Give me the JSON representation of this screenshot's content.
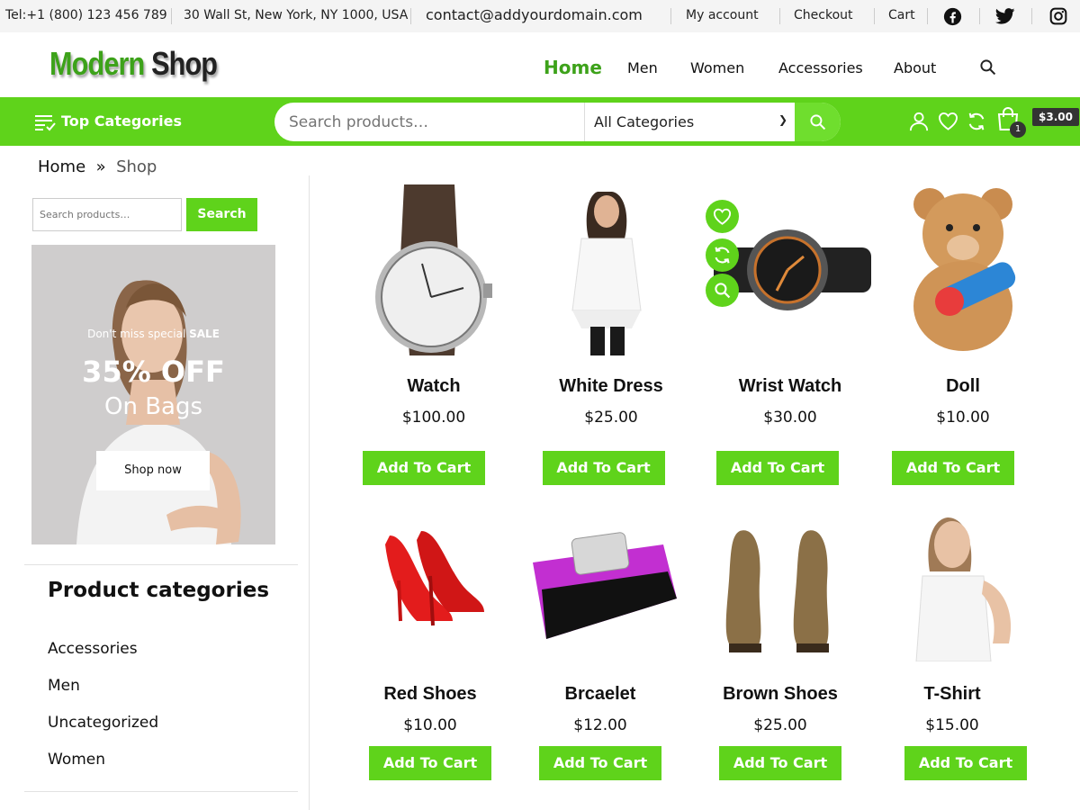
{
  "topbar": {
    "tel": "Tel:+1 (800) 123 456 789",
    "address": "30 Wall St, New York, NY 1000, USA",
    "email": "contact@addyourdomain.com",
    "my_account": "My account",
    "checkout": "Checkout",
    "cart": "Cart"
  },
  "brand": {
    "part1": "Modern",
    "part2": "Shop",
    "accent": "#3da21a",
    "bar": "#5fd31b"
  },
  "nav": {
    "home": "Home",
    "men": "Men",
    "women": "Women",
    "accessories": "Accessories",
    "about": "About"
  },
  "bar": {
    "top_categories": "Top Categories",
    "search_placeholder": "Search products…",
    "category_select": "All Categories",
    "cart_total": "$3.00",
    "cart_count": "1"
  },
  "breadcrumb": {
    "home": "Home",
    "sep": "»",
    "current": "Shop"
  },
  "sidebar": {
    "search_placeholder": "Search products…",
    "search_button": "Search",
    "banner": {
      "line1_pre": "Don't miss special ",
      "line1_sale": "SALE",
      "line2": "35% OFF",
      "line3": "On Bags",
      "button": "Shop now"
    },
    "categories_title": "Product categories",
    "categories": [
      "Accessories",
      "Men",
      "Uncategorized",
      "Women"
    ]
  },
  "products": [
    {
      "name": "Watch",
      "price": "$100.00",
      "button": "Add To Cart",
      "image": "watch-image"
    },
    {
      "name": "White Dress",
      "price": "$25.00",
      "button": "Add To Cart",
      "image": "dress-image"
    },
    {
      "name": "Wrist Watch",
      "price": "$30.00",
      "button": "Add To Cart",
      "image": "wrist-watch-image"
    },
    {
      "name": "Doll",
      "price": "$10.00",
      "button": "Add To Cart",
      "image": "teddy-bear-image"
    },
    {
      "name": "Red Shoes",
      "price": "$10.00",
      "button": "Add To Cart",
      "image": "red-shoes-image"
    },
    {
      "name": "Brcaelet",
      "price": "$12.00",
      "button": "Add To Cart",
      "image": "bracelet-image"
    },
    {
      "name": "Brown Shoes",
      "price": "$25.00",
      "button": "Add To Cart",
      "image": "brown-shoes-image"
    },
    {
      "name": "T-Shirt",
      "price": "$15.00",
      "button": "Add To Cart",
      "image": "tshirt-image"
    }
  ]
}
